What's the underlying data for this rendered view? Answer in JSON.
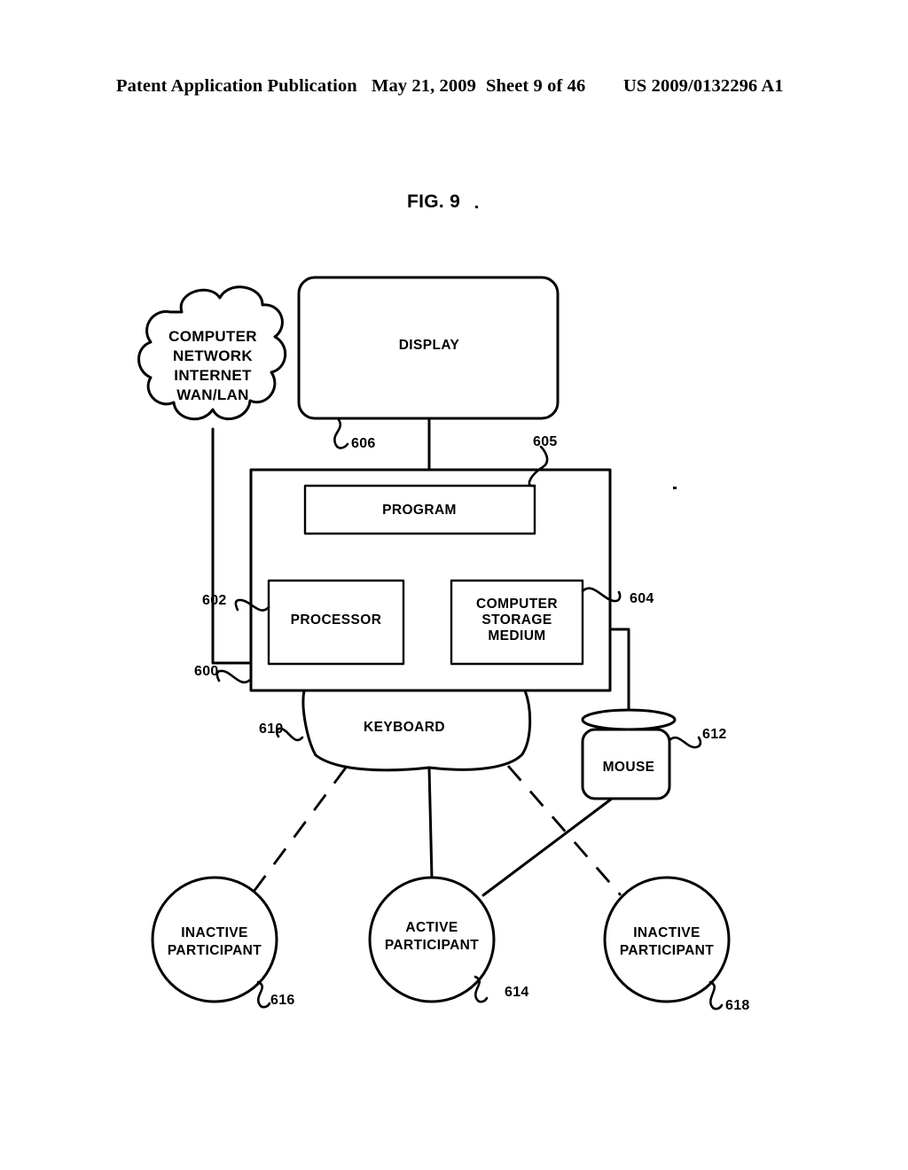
{
  "header": {
    "publication": "Patent Application Publication",
    "date": "May 21, 2009",
    "sheet": "Sheet 9 of 46",
    "document_number": "US 2009/0132296 A1"
  },
  "figure": {
    "title": "FIG. 9",
    "nodes": {
      "network_cloud": {
        "lines": [
          "COMPUTER",
          "NETWORK",
          "INTERNET",
          "WAN/LAN"
        ]
      },
      "display": {
        "label": "DISPLAY",
        "ref": "606"
      },
      "program": {
        "label": "PROGRAM",
        "ref": "605"
      },
      "processor": {
        "label": "PROCESSOR",
        "ref": "602"
      },
      "storage": {
        "lines": [
          "COMPUTER",
          "STORAGE",
          "MEDIUM"
        ],
        "ref": "604"
      },
      "chassis": {
        "ref": "600"
      },
      "keyboard": {
        "label": "KEYBOARD",
        "ref": "610"
      },
      "mouse": {
        "label": "MOUSE",
        "ref": "612"
      },
      "participant_left": {
        "lines": [
          "INACTIVE",
          "PARTICIPANT"
        ],
        "ref": "616"
      },
      "participant_center": {
        "lines": [
          "ACTIVE",
          "PARTICIPANT"
        ],
        "ref": "614"
      },
      "participant_right": {
        "lines": [
          "INACTIVE",
          "PARTICIPANT"
        ],
        "ref": "618"
      }
    },
    "colors": {
      "ink": "#000000",
      "paper": "#ffffff"
    }
  }
}
